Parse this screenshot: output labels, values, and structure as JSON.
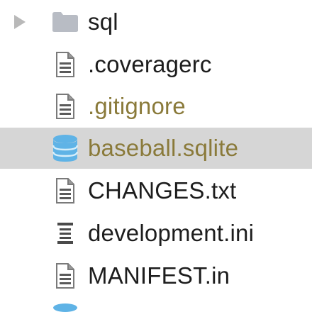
{
  "tree": {
    "items": [
      {
        "label": "sql",
        "kind": "folder",
        "expanded": false
      },
      {
        "label": ".coveragerc",
        "kind": "file"
      },
      {
        "label": ".gitignore",
        "kind": "file",
        "status": "ignored"
      },
      {
        "label": "baseball.sqlite",
        "kind": "database",
        "selected": true
      },
      {
        "label": "CHANGES.txt",
        "kind": "file"
      },
      {
        "label": "development.ini",
        "kind": "config"
      },
      {
        "label": "MANIFEST.in",
        "kind": "file"
      }
    ]
  },
  "colors": {
    "selection": "#d6d6d6",
    "ignored_text": "#8a7a3a",
    "folder": "#b8bcc4",
    "database_icon": "#5fb3e6"
  },
  "icons": [
    "chevron-right-icon",
    "folder-icon",
    "document-icon",
    "database-icon",
    "config-file-icon"
  ]
}
